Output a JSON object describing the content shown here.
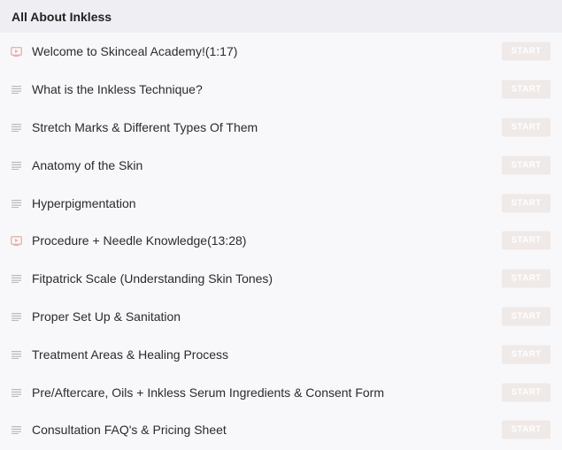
{
  "section": {
    "title": "All About Inkless"
  },
  "lectures": [
    {
      "title": "Welcome to Skinceal Academy!(1:17)",
      "icon": "video-icon",
      "button": "START"
    },
    {
      "title": "What is the Inkless Technique?",
      "icon": "text-icon",
      "button": "START"
    },
    {
      "title": "Stretch Marks & Different Types Of Them",
      "icon": "text-icon",
      "button": "START"
    },
    {
      "title": "Anatomy of the Skin",
      "icon": "text-icon",
      "button": "START"
    },
    {
      "title": "Hyperpigmentation",
      "icon": "text-icon",
      "button": "START"
    },
    {
      "title": "Procedure + Needle Knowledge(13:28)",
      "icon": "video-icon",
      "button": "START"
    },
    {
      "title": "Fitpatrick Scale (Understanding Skin Tones)",
      "icon": "text-icon",
      "button": "START"
    },
    {
      "title": "Proper Set Up & Sanitation",
      "icon": "text-icon",
      "button": "START"
    },
    {
      "title": "Treatment Areas & Healing Process",
      "icon": "text-icon",
      "button": "START"
    },
    {
      "title": "Pre/Aftercare, Oils + Inkless Serum Ingredients & Consent Form",
      "icon": "text-icon",
      "button": "START"
    },
    {
      "title": "Consultation FAQ's & Pricing Sheet",
      "icon": "text-icon",
      "button": "START"
    }
  ],
  "colors": {
    "video_icon": "#e8a9a4",
    "text_icon": "#b9b9b9",
    "start_button_bg": "#efe9e8",
    "header_bg": "#eeeef3"
  }
}
